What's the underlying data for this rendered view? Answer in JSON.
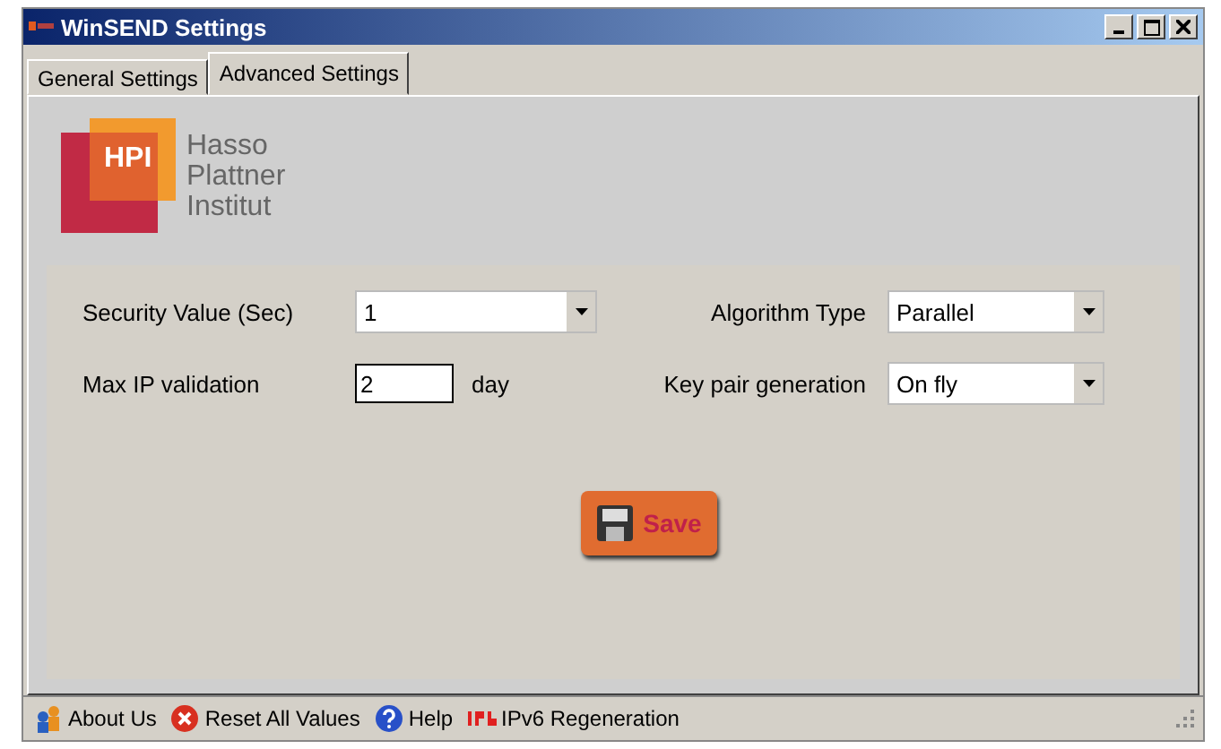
{
  "window": {
    "title": "WinSEND Settings"
  },
  "tabs": [
    {
      "label": "General Settings",
      "selected": false
    },
    {
      "label": "Advanced Settings",
      "selected": true
    }
  ],
  "logo": {
    "mark": "HPI",
    "lines": [
      "Hasso",
      "Plattner",
      "Institut"
    ]
  },
  "fields": [
    {
      "kind": "dropdown",
      "label": "Security Value (Sec)",
      "value": "1"
    },
    {
      "kind": "dropdown",
      "label": "Algorithm Type",
      "value": "Parallel"
    },
    {
      "kind": "text",
      "label": "Max IP validation",
      "value": "2",
      "unit": "day"
    },
    {
      "kind": "dropdown",
      "label": "Key pair generation",
      "value": "On fly"
    }
  ],
  "save_button": {
    "label": "Save"
  },
  "status_bar": [
    {
      "kind": "about",
      "label": "About Us"
    },
    {
      "kind": "reset",
      "label": "Reset All Values"
    },
    {
      "kind": "help",
      "label": "Help"
    },
    {
      "kind": "ipv6",
      "label": "IPv6 Regeneration"
    }
  ]
}
